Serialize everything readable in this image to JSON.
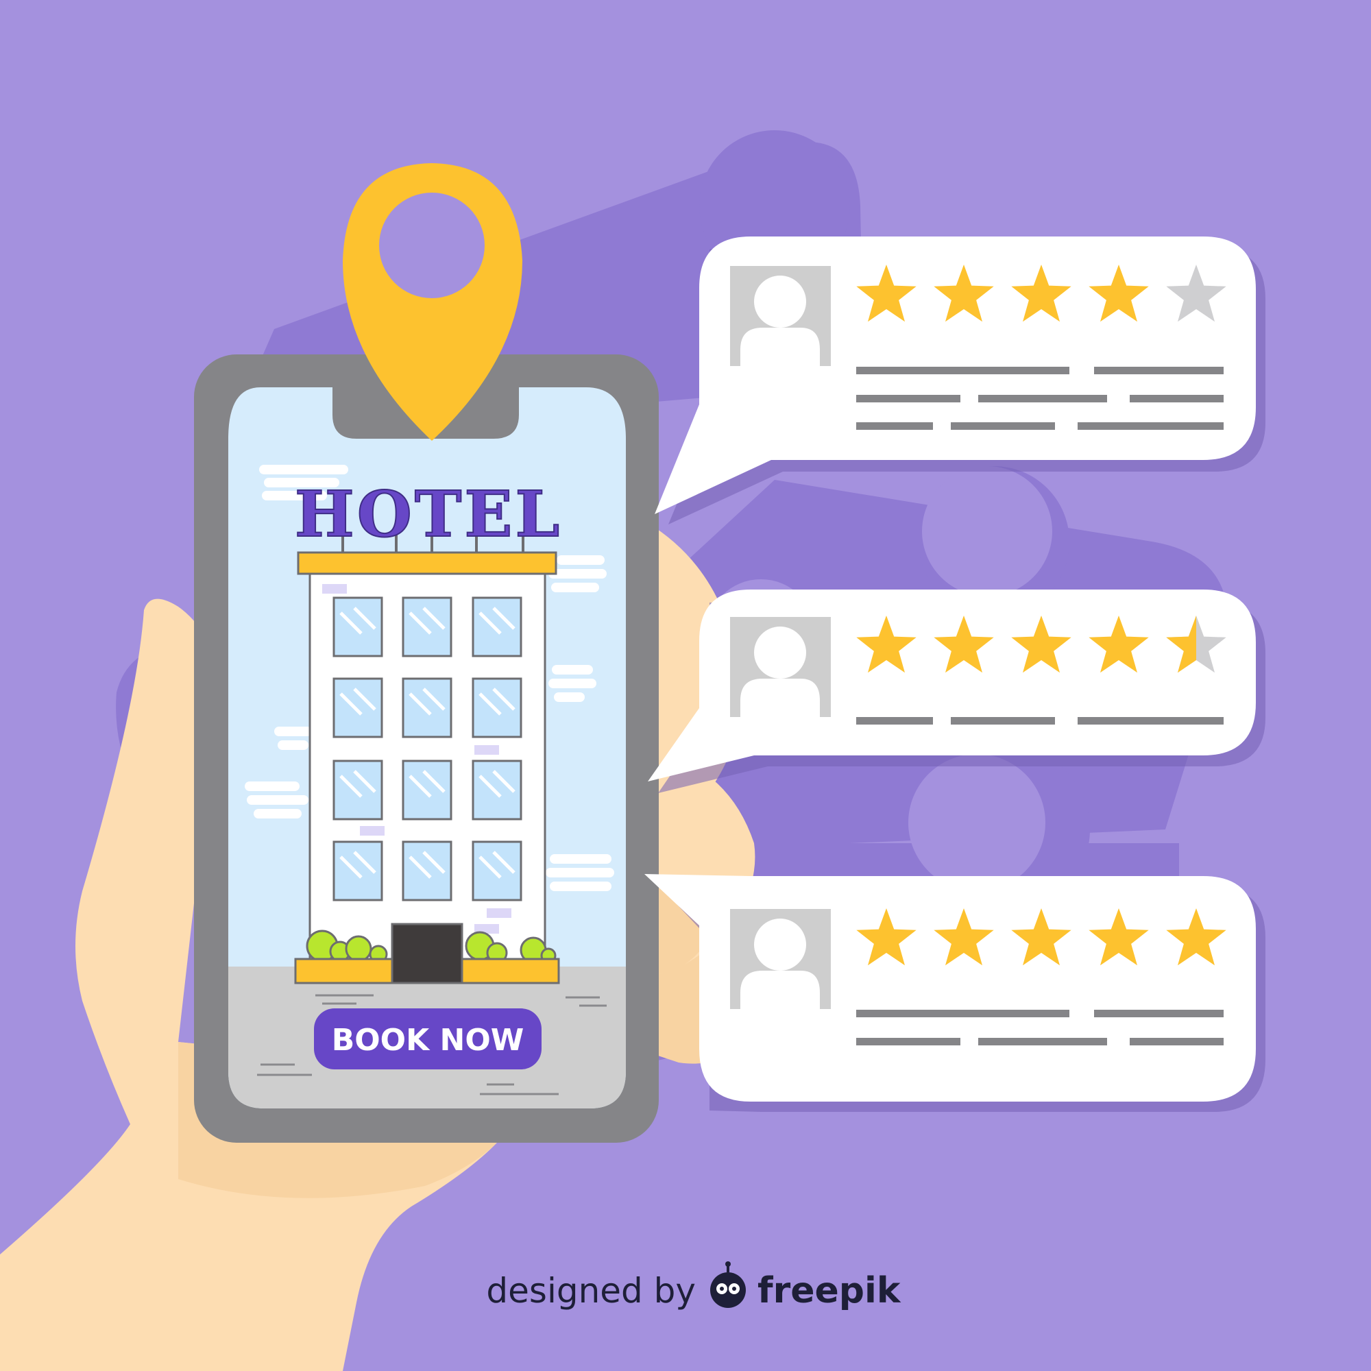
{
  "colors": {
    "background": "#a491de",
    "blob": "#8f7ad3",
    "accent_yellow": "#fdc22f",
    "brand_purple": "#6747c7",
    "phone_frame": "#858588",
    "screen_sky": "#d6ecfc",
    "skin": "#fdddb2",
    "star_empty": "#cfcfd1"
  },
  "phone": {
    "sign_text": "HOTEL",
    "cta_label": "BOOK NOW",
    "pin_icon": "map-pin-icon"
  },
  "reviews": [
    {
      "avatar_icon": "user-avatar-icon",
      "rating": 4.0,
      "max": 5
    },
    {
      "avatar_icon": "user-avatar-icon",
      "rating": 4.5,
      "max": 5
    },
    {
      "avatar_icon": "user-avatar-icon",
      "rating": 5.0,
      "max": 5
    }
  ],
  "credit": {
    "prefix": "designed by",
    "brand": "freepik"
  }
}
